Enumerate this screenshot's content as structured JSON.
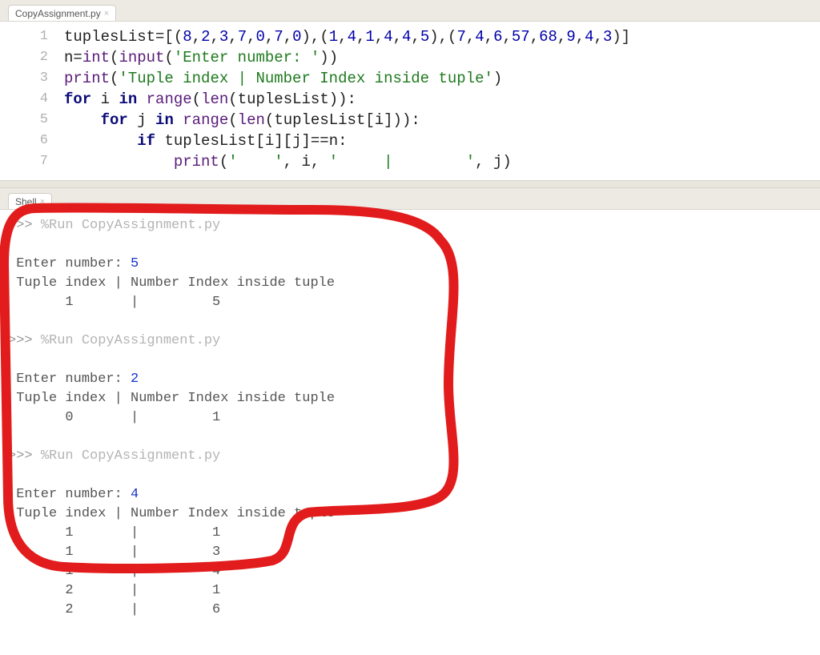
{
  "tabs": {
    "editor": "CopyAssignment.py",
    "shell": "Shell"
  },
  "code": {
    "lines": [
      1,
      2,
      3,
      4,
      5,
      6,
      7
    ],
    "l1": {
      "a": "tuplesList",
      "eq": "=[(",
      "n1": "8",
      "c1": ",",
      "n2": "2",
      "c2": ",",
      "n3": "3",
      "c3": ",",
      "n4": "7",
      "c4": ",",
      "n5": "0",
      "c5": ",",
      "n6": "7",
      "c6": ",",
      "n7": "0",
      "close1": "),(",
      "m1": "1",
      "mc1": ",",
      "m2": "4",
      "mc2": ",",
      "m3": "1",
      "mc3": ",",
      "m4": "4",
      "mc4": ",",
      "m5": "4",
      "mc5": ",",
      "m6": "5",
      "close2": "),(",
      "p1": "7",
      "pc1": ",",
      "p2": "4",
      "pc2": ",",
      "p3": "6",
      "pc3": ",",
      "p4": "57",
      "pc4": ",",
      "p5": "68",
      "pc5": ",",
      "p6": "9",
      "pc6": ",",
      "p7": "4",
      "pc7": ",",
      "p8": "3",
      "close3": ")]"
    },
    "l2": {
      "v": "n",
      "eq": "=",
      "b1": "int",
      "op": "(",
      "b2": "input",
      "op2": "(",
      "s": "'Enter number: '",
      "cl": "))"
    },
    "l3": {
      "b": "print",
      "op": "(",
      "s": "'Tuple index | Number Index inside tuple'",
      "cl": ")"
    },
    "l4": {
      "k1": "for",
      "sp": " ",
      "v": "i",
      "sp2": " ",
      "k2": "in",
      "sp3": " ",
      "b": "range",
      "op": "(",
      "b2": "len",
      "op2": "(",
      "a": "tuplesList",
      "cl": ")):"
    },
    "l5": {
      "indent": "    ",
      "k1": "for",
      "sp": " ",
      "v": "j",
      "sp2": " ",
      "k2": "in",
      "sp3": " ",
      "b": "range",
      "op": "(",
      "b2": "len",
      "op2": "(",
      "a": "tuplesList[i]",
      "cl": ")):"
    },
    "l6": {
      "indent": "        ",
      "k": "if",
      "sp": " ",
      "a": "tuplesList[i][j]",
      "eq": "==",
      "v": "n",
      ":": ":"
    },
    "l7": {
      "indent": "            ",
      "b": "print",
      "op": "(",
      "s1": "'    '",
      "c1": ", i, ",
      "s2": "'     |        '",
      "c2": ", j)"
    }
  },
  "shell": {
    "run_prefix": ">>> ",
    "run_cmd": "%Run CopyAssignment.py",
    "runs": [
      {
        "input_prompt": " Enter number: ",
        "input_value": "5",
        "header": " Tuple index | Number Index inside tuple",
        "rows": [
          "       1       |         5"
        ]
      },
      {
        "input_prompt": " Enter number: ",
        "input_value": "2",
        "header": " Tuple index | Number Index inside tuple",
        "rows": [
          "       0       |         1"
        ]
      },
      {
        "input_prompt": " Enter number: ",
        "input_value": "4",
        "header": " Tuple index | Number Index inside tuple",
        "rows": [
          "       1       |         1",
          "       1       |         3",
          "       1       |         4",
          "       2       |         1",
          "       2       |         6"
        ]
      }
    ]
  }
}
